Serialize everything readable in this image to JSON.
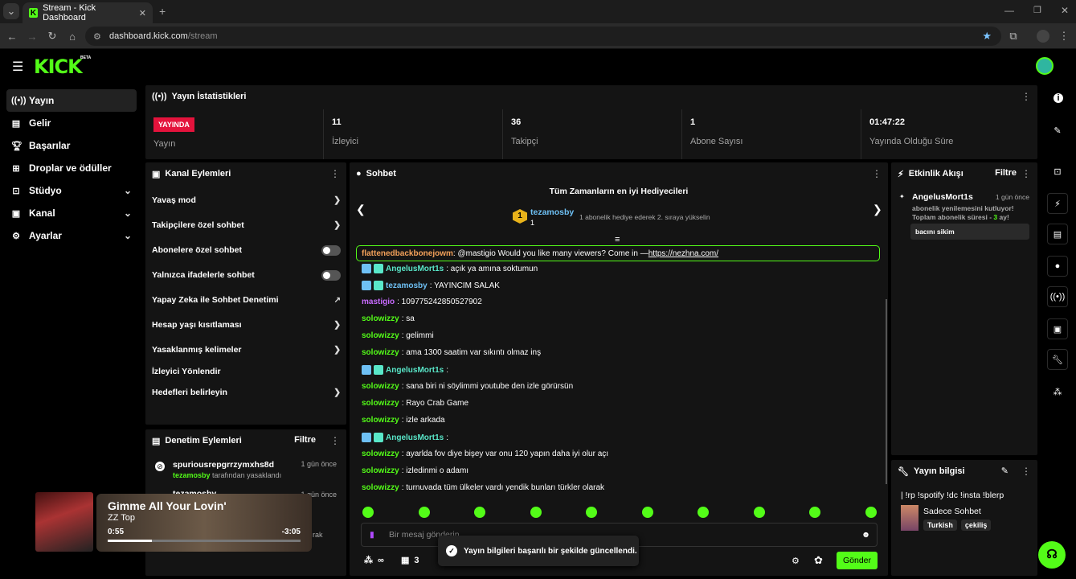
{
  "browser": {
    "tab_title": "Stream - Kick Dashboard",
    "url_host": "dashboard.kick.com",
    "url_path": "/stream"
  },
  "header": {
    "logo": "KICK",
    "beta": "BETA"
  },
  "sidebar": {
    "items": [
      {
        "label": "Yayın",
        "icon": "broadcast-icon"
      },
      {
        "label": "Gelir",
        "icon": "revenue-icon"
      },
      {
        "label": "Başarılar",
        "icon": "trophy-icon"
      },
      {
        "label": "Droplar ve ödüller",
        "icon": "drops-icon"
      },
      {
        "label": "Stüdyo",
        "icon": "studio-icon"
      },
      {
        "label": "Kanal",
        "icon": "channel-icon"
      },
      {
        "label": "Ayarlar",
        "icon": "gear-icon"
      }
    ]
  },
  "stats": {
    "title": "Yayın İstatistikleri",
    "live_badge": "YAYINDA",
    "live_label": "Yayın",
    "viewers": "11",
    "viewers_label": "İzleyici",
    "followers": "36",
    "followers_label": "Takipçi",
    "subs": "1",
    "subs_label": "Abone Sayısı",
    "uptime": "01:47:22",
    "uptime_label": "Yayında Olduğu Süre"
  },
  "channel_actions": {
    "title": "Kanal Eylemleri",
    "items": [
      "Yavaş mod",
      "Takipçilere özel sohbet",
      "Abonelere özel sohbet",
      "Yalnızca ifadelerle sohbet",
      "Yapay Zeka ile Sohbet Denetimi",
      "Hesap yaşı kısıtlaması",
      "Yasaklanmış kelimeler",
      "İzleyici Yönlendir",
      "Hedefleri belirleyin"
    ]
  },
  "mod_actions": {
    "title": "Denetim Eylemleri",
    "filter": "Filtre",
    "items": [
      {
        "user": "spuriousrepgrrzymxhs8d",
        "by": "tezamosby",
        "action": "tarafından yasaklandı",
        "time": "1 gün önce"
      },
      {
        "user": "tezamosby",
        "time": "1 gün önce",
        "trail": "rak"
      }
    ]
  },
  "chat": {
    "title": "Sohbet",
    "gifters_title": "Tüm Zamanların en iyi Hediyecileri",
    "top_gifter": "tezamosby",
    "top_rank": "1",
    "top_count": "1",
    "top_note": "1 abonelik hediye ederek 2. sıraya yükselin",
    "pinned_user": "flattenedbackbonejowm",
    "pinned_text": ": @mastigio Would you like many viewers? Come in — ",
    "pinned_link": "https://nezhna.com/",
    "messages": [
      {
        "user": "AngelusMort1s",
        "text": ": açık ya amına soktumun",
        "color": "#59e7c9"
      },
      {
        "user": "tezamosby",
        "text": ": YAYINCIM SALAK",
        "color": "#6ec0f4"
      },
      {
        "user": "mastigio",
        "text": ": 109775242850527902",
        "color": "#c86bff"
      },
      {
        "user": "solowizzy",
        "text": ": sa",
        "color": "#53fc18"
      },
      {
        "user": "solowizzy",
        "text": ": gelimmi",
        "color": "#53fc18"
      },
      {
        "user": "solowizzy",
        "text": ": ama 1300 saatim var sıkıntı olmaz inş",
        "color": "#53fc18"
      },
      {
        "user": "AngelusMort1s",
        "text": ":",
        "color": "#59e7c9"
      },
      {
        "user": "solowizzy",
        "text": ": sana biri ni söylimmi youtube den izle görürsün",
        "color": "#53fc18"
      },
      {
        "user": "solowizzy",
        "text": ": Rayo Crab Game",
        "color": "#53fc18"
      },
      {
        "user": "solowizzy",
        "text": ": izle arkada",
        "color": "#53fc18"
      },
      {
        "user": "AngelusMort1s",
        "text": ":",
        "color": "#59e7c9"
      },
      {
        "user": "solowizzy",
        "text": ": ayarlda fov diye bişey var onu 120 yapın daha iyi olur açı",
        "color": "#53fc18"
      },
      {
        "user": "solowizzy",
        "text": ": izledinmi o adamı",
        "color": "#53fc18"
      },
      {
        "user": "solowizzy",
        "text": ": turnuvada tüm ülkeler vardı yendik bunları türkler olarak",
        "color": "#53fc18"
      }
    ],
    "input_placeholder": "Bir mesaj gönderin",
    "points": "∞",
    "gift_count": "3",
    "send": "Gönder"
  },
  "events": {
    "title": "Etkinlik Akışı",
    "filter": "Filtre",
    "user": "AngelusMort1s",
    "time": "1 gün önce",
    "line1": "abonelik yenilemesini kutluyor!",
    "line2a": "Toplam abonelik süresi - ",
    "months": "3",
    "line2b": " ay!",
    "message": "bacını sikim"
  },
  "stream_info": {
    "title": "Yayın bilgisi",
    "stream_title": "| !rp !spotify !dc !insta !blerp",
    "category": "Sadece Sohbet",
    "tags": [
      "Turkish",
      "çekiliş"
    ]
  },
  "toast": {
    "text": "Yayın bilgileri başarılı bir şekilde güncellendi."
  },
  "media": {
    "title": "Gimme All Your Lovin'",
    "artist": "ZZ Top",
    "elapsed": "0:55",
    "remaining": "-3:05",
    "progress": 0.23
  },
  "colors": {
    "accent": "#53fc18",
    "live": "#e4133c",
    "panel": "#141414"
  }
}
